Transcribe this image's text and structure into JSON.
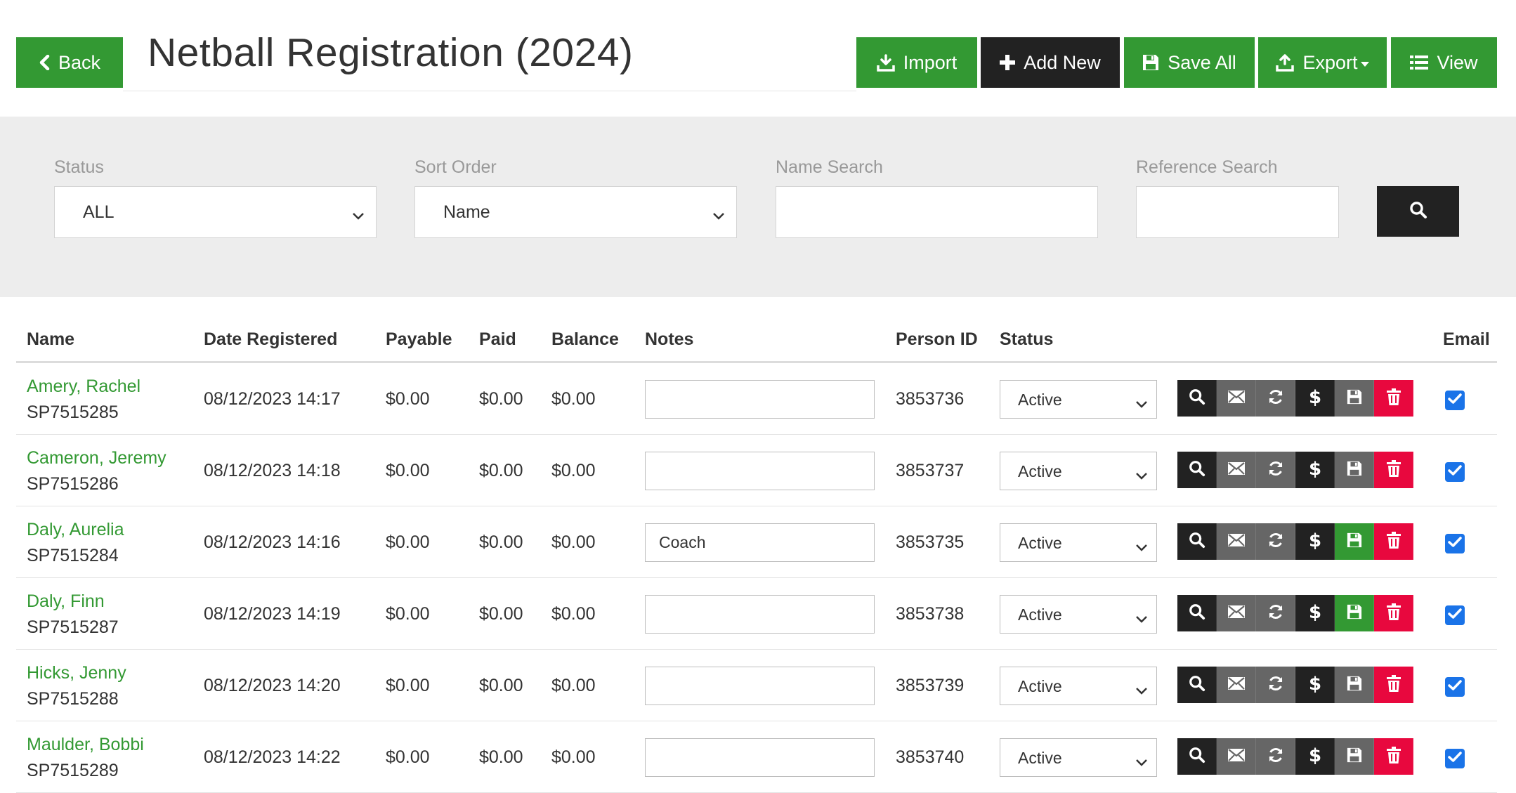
{
  "header": {
    "back_label": "Back",
    "title": "Netball Registration (2024)",
    "import_label": "Import",
    "add_new_label": "Add New",
    "save_all_label": "Save All",
    "export_label": "Export",
    "view_label": "View"
  },
  "filters": {
    "status_label": "Status",
    "status_value": "ALL",
    "sort_label": "Sort Order",
    "sort_value": "Name",
    "name_search_label": "Name Search",
    "name_search_value": "",
    "reference_search_label": "Reference Search",
    "reference_search_value": ""
  },
  "table": {
    "columns": {
      "name": "Name",
      "date_registered": "Date Registered",
      "payable": "Payable",
      "paid": "Paid",
      "balance": "Balance",
      "notes": "Notes",
      "person_id": "Person ID",
      "status": "Status",
      "email": "Email"
    },
    "rows": [
      {
        "name": "Amery, Rachel",
        "ref": "SP7515285",
        "date": "08/12/2023 14:17",
        "payable": "$0.00",
        "paid": "$0.00",
        "balance": "$0.00",
        "notes": "",
        "person_id": "3853736",
        "status": "Active",
        "email_checked": true,
        "save_highlight": false
      },
      {
        "name": "Cameron, Jeremy",
        "ref": "SP7515286",
        "date": "08/12/2023 14:18",
        "payable": "$0.00",
        "paid": "$0.00",
        "balance": "$0.00",
        "notes": "",
        "person_id": "3853737",
        "status": "Active",
        "email_checked": true,
        "save_highlight": false
      },
      {
        "name": "Daly, Aurelia",
        "ref": "SP7515284",
        "date": "08/12/2023 14:16",
        "payable": "$0.00",
        "paid": "$0.00",
        "balance": "$0.00",
        "notes": "Coach",
        "person_id": "3853735",
        "status": "Active",
        "email_checked": true,
        "save_highlight": true
      },
      {
        "name": "Daly, Finn",
        "ref": "SP7515287",
        "date": "08/12/2023 14:19",
        "payable": "$0.00",
        "paid": "$0.00",
        "balance": "$0.00",
        "notes": "",
        "person_id": "3853738",
        "status": "Active",
        "email_checked": true,
        "save_highlight": true
      },
      {
        "name": "Hicks, Jenny",
        "ref": "SP7515288",
        "date": "08/12/2023 14:20",
        "payable": "$0.00",
        "paid": "$0.00",
        "balance": "$0.00",
        "notes": "",
        "person_id": "3853739",
        "status": "Active",
        "email_checked": true,
        "save_highlight": false
      },
      {
        "name": "Maulder, Bobbi",
        "ref": "SP7515289",
        "date": "08/12/2023 14:22",
        "payable": "$0.00",
        "paid": "$0.00",
        "balance": "$0.00",
        "notes": "",
        "person_id": "3853740",
        "status": "Active",
        "email_checked": true,
        "save_highlight": false
      }
    ]
  },
  "colors": {
    "brand_green": "#339933",
    "dark": "#222222",
    "grey_button": "#666666",
    "delete_red": "#e8083e",
    "filter_bg": "#ededed",
    "checkbox_blue": "#1a73e8"
  }
}
